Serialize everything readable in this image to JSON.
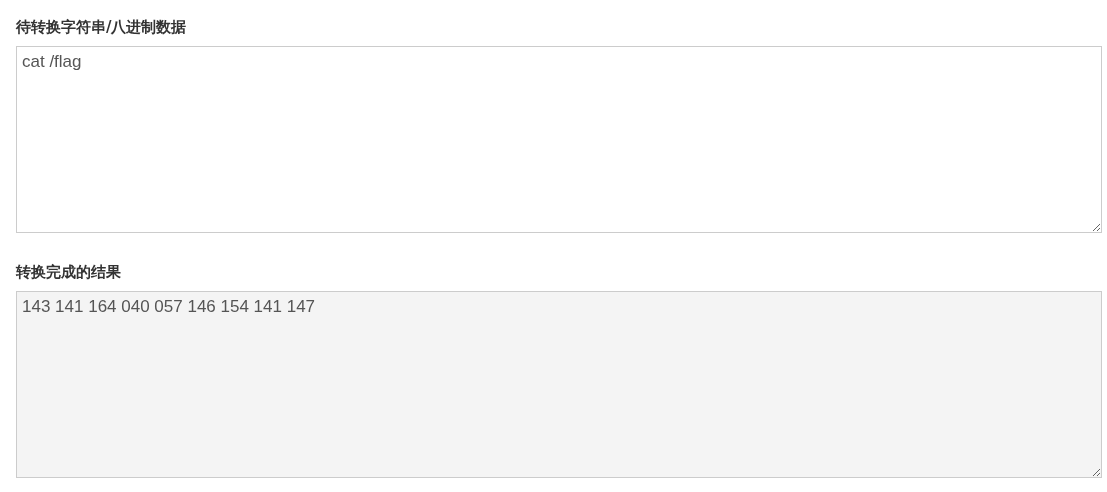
{
  "fields": [
    {
      "kind": "input",
      "label": "待转换字符串/八进制数据",
      "value": "cat /flag"
    },
    {
      "kind": "output",
      "label": "转换完成的结果",
      "value": "143 141 164 040 057 146 154 141 147"
    }
  ]
}
